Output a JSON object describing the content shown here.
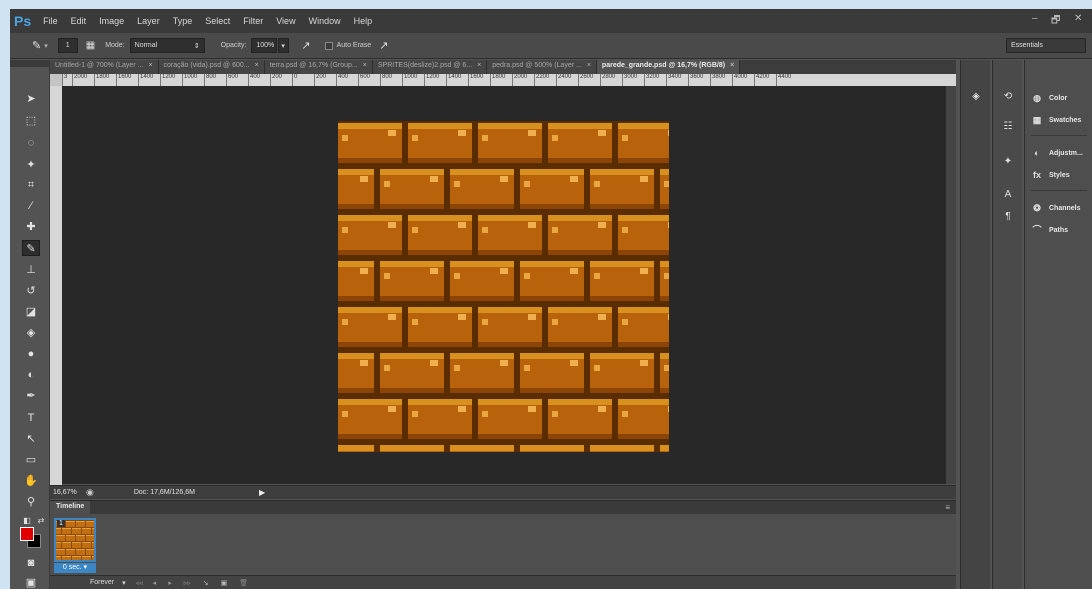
{
  "app": {
    "logo": "Ps"
  },
  "menu": [
    "File",
    "Edit",
    "Image",
    "Layer",
    "Type",
    "Select",
    "Filter",
    "View",
    "Window",
    "Help"
  ],
  "window_controls": {
    "minimize": "–",
    "restore": "🗗",
    "close": "✕"
  },
  "options": {
    "brush_size": "1",
    "mode_label": "Mode:",
    "mode_value": "Normal",
    "opacity_label": "Opacity:",
    "opacity_value": "100%",
    "auto_erase_label": "Auto Erase",
    "workspace": "Essentials"
  },
  "tabs": [
    {
      "label": "Untitled-1 @ 700% (Layer ...",
      "active": false
    },
    {
      "label": "coração (vida).psd @ 600...",
      "active": false
    },
    {
      "label": "terra.psd @ 16,7% (Group...",
      "active": false
    },
    {
      "label": "SPRITES(deslize)2.psd @ 6...",
      "active": false
    },
    {
      "label": "pedra.psd @ 500% (Layer ...",
      "active": false
    },
    {
      "label": "parede_grande.psd @ 16,7% (RGB/8)",
      "active": true
    }
  ],
  "tab_close": "×",
  "ruler_ticks": [
    "3",
    "2000",
    "1800",
    "1600",
    "1400",
    "1200",
    "1000",
    "800",
    "600",
    "400",
    "200",
    "0",
    "200",
    "400",
    "600",
    "800",
    "1000",
    "1200",
    "1400",
    "1600",
    "1800",
    "2000",
    "2200",
    "2400",
    "2600",
    "2800",
    "3000",
    "3200",
    "3400",
    "3600",
    "3800",
    "4000",
    "4200",
    "4400"
  ],
  "status": {
    "zoom": "16,67%",
    "doc": "Doc: 17,6M/126,6M"
  },
  "timeline": {
    "title": "Timeline",
    "frame_number": "1",
    "frame_delay": "0 sec. ▾",
    "loop": "Forever"
  },
  "panels": {
    "group1": [
      "Color",
      "Swatches"
    ],
    "group2": [
      "Adjustm...",
      "Styles"
    ],
    "group3": [
      "Channels",
      "Paths"
    ]
  },
  "colors": {
    "foreground": "#e00000",
    "background": "#000000",
    "brick_main": "#b8620c",
    "mortar": "#5a2d00"
  }
}
